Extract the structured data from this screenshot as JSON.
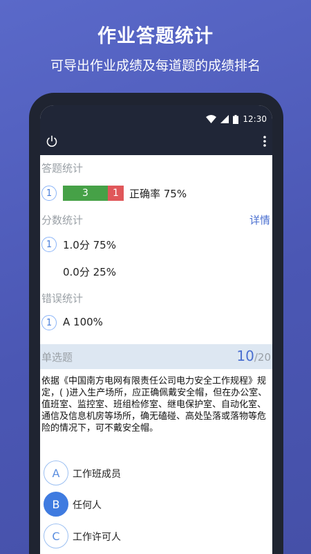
{
  "hero": {
    "title": "作业答题统计",
    "subtitle": "可导出作业成绩及每道题的成绩排名"
  },
  "status_bar": {
    "time": "12:30"
  },
  "app_bar": {
    "left_icon": "power-icon",
    "right_icon": "more-vert-icon"
  },
  "answer_stats": {
    "label": "答题统计",
    "index": "1",
    "correct_count": "3",
    "wrong_count": "1",
    "accuracy_text": "正确率 75%",
    "accuracy_fraction": 0.75
  },
  "score_stats": {
    "label": "分数统计",
    "detail_link": "详情",
    "index": "1",
    "rows": [
      {
        "text": "1.0分 75%"
      },
      {
        "text": "0.0分 25%"
      }
    ]
  },
  "error_stats": {
    "label": "错误统计",
    "index": "1",
    "text": "A 100%"
  },
  "question": {
    "type": "单选题",
    "current": "10",
    "total": "/20",
    "stem": "依据《中国南方电网有限责任公司电力安全工作规程》规定，( )进入生产场所，应正确佩戴安全帽，但在办公室、值班室、监控室、班组检修室、继电保护室、自动化室、通信及信息机房等场所，确无磕碰、高处坠落或落物等危险的情况下，可不戴安全帽。",
    "options": [
      {
        "letter": "A",
        "text": "工作班成员",
        "selected": false
      },
      {
        "letter": "B",
        "text": "任何人",
        "selected": true
      },
      {
        "letter": "C",
        "text": "工作许可人",
        "selected": false
      }
    ]
  },
  "colors": {
    "background": "#4b57b4",
    "correct_bar": "#46a147",
    "wrong_bar": "#e0575a",
    "accent": "#4a6fd0",
    "selected_option": "#3f7be0"
  }
}
